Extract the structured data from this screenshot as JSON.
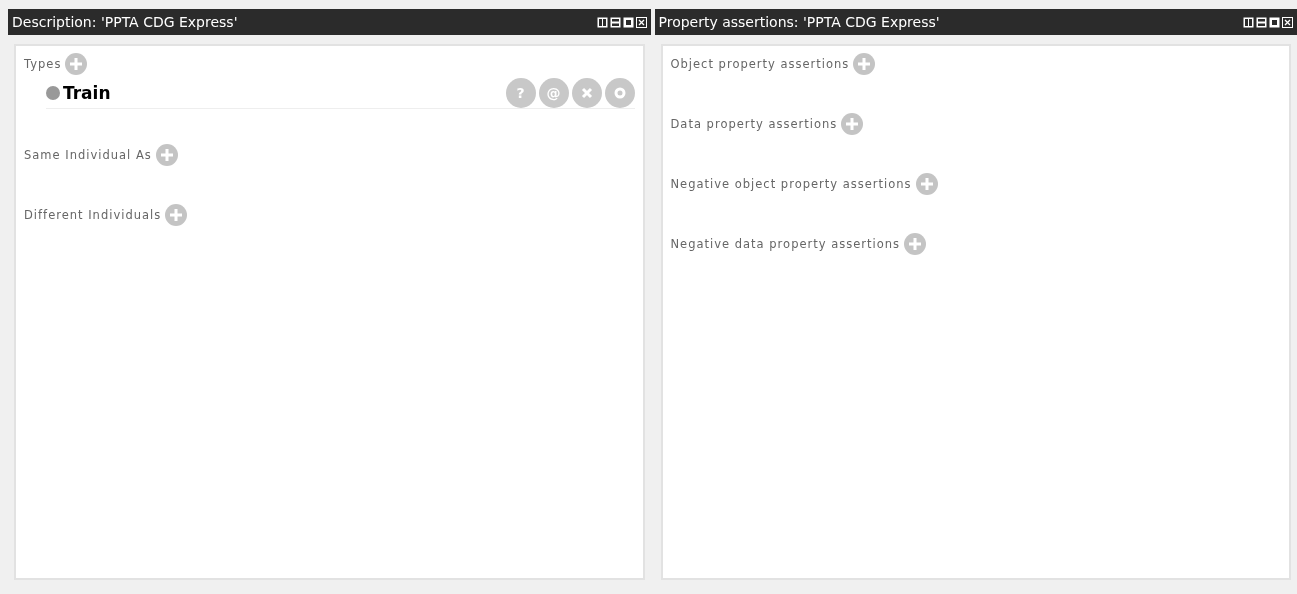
{
  "panels": [
    {
      "title": "Description: 'PPTA CDG Express'",
      "sections": [
        {
          "label": "Types",
          "items": [
            {
              "label": "Train",
              "actions": [
                {
                  "kind": "text",
                  "label": "?"
                },
                {
                  "kind": "text",
                  "label": "@"
                },
                {
                  "kind": "delete"
                },
                {
                  "kind": "edit"
                }
              ]
            }
          ]
        },
        {
          "label": "Same Individual As"
        },
        {
          "label": "Different Individuals"
        }
      ]
    },
    {
      "title": "Property assertions: 'PPTA CDG Express'",
      "sections": [
        {
          "label": "Object property assertions"
        },
        {
          "label": "Data property assertions"
        },
        {
          "label": "Negative object property assertions"
        },
        {
          "label": "Negative data property assertions"
        }
      ]
    }
  ]
}
